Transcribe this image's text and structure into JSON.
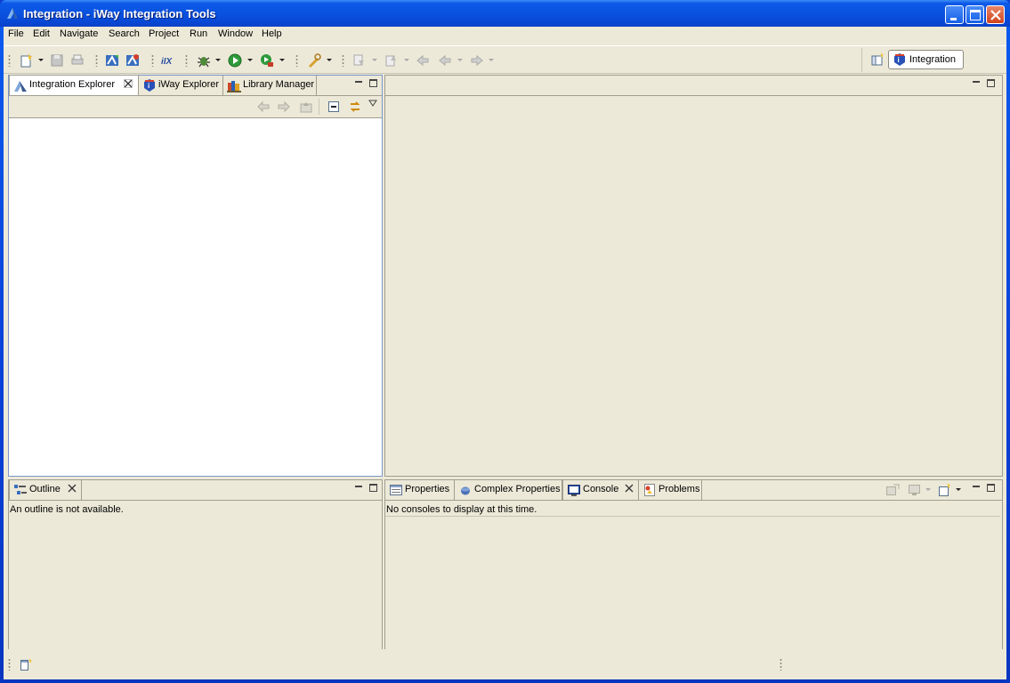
{
  "window": {
    "title": "Integration - iWay Integration Tools"
  },
  "menu": {
    "items": [
      "File",
      "Edit",
      "Navigate",
      "Search",
      "Project",
      "Run",
      "Window",
      "Help"
    ]
  },
  "perspective": {
    "label": "Integration"
  },
  "explorer": {
    "tabs": [
      {
        "label": "Integration Explorer",
        "icon": "integration-explorer-icon"
      },
      {
        "label": "iWay Explorer",
        "icon": "iway-explorer-icon"
      },
      {
        "label": "Library Manager",
        "icon": "library-manager-icon"
      }
    ]
  },
  "outline": {
    "tab_label": "Outline",
    "message": "An outline is not available."
  },
  "bottom": {
    "tabs": [
      {
        "label": "Properties",
        "icon": "properties-icon"
      },
      {
        "label": "Complex Properties",
        "icon": "complex-properties-icon"
      },
      {
        "label": "Console",
        "icon": "console-icon"
      },
      {
        "label": "Problems",
        "icon": "problems-icon"
      }
    ],
    "console_message": "No consoles to display at this time."
  },
  "colors": {
    "titlebar": "#0a52e0",
    "chrome": "#ece9d8",
    "active_border": "#7a96c8"
  }
}
